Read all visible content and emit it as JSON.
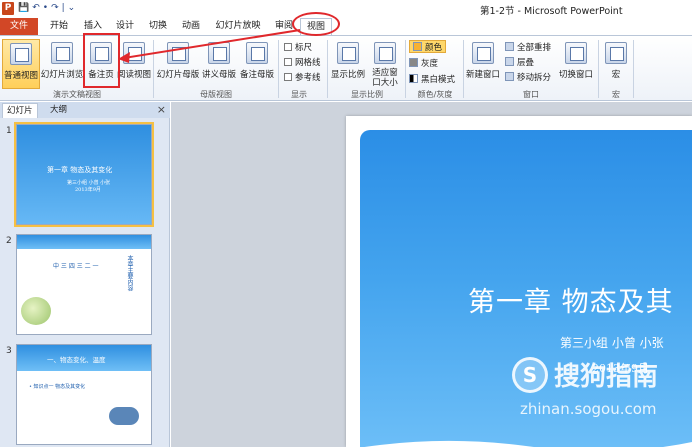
{
  "window": {
    "app_logo": "P",
    "title": "第1-2节 - Microsoft PowerPoint",
    "qat": [
      "💾",
      "↶",
      "•",
      "↷",
      "|",
      "⌄"
    ]
  },
  "tabs": {
    "file": "文件",
    "items": [
      "开始",
      "插入",
      "设计",
      "切换",
      "动画",
      "幻灯片放映",
      "审阅",
      "视图"
    ],
    "active": "视图"
  },
  "ribbon": {
    "presentation_views": {
      "label": "演示文稿视图",
      "normal": "普通视图",
      "slide_sorter": "幻灯片浏览",
      "notes_page": "备注页",
      "reading_view": "阅读视图"
    },
    "master_views": {
      "label": "母版视图",
      "slide_master": "幻灯片母版",
      "handout_master": "讲义母版",
      "notes_master": "备注母版"
    },
    "show": {
      "label": "显示",
      "ruler": "标尺",
      "gridlines": "网格线",
      "guides": "参考线"
    },
    "zoom": {
      "label": "显示比例",
      "zoom": "显示比例",
      "fit_window": "适应窗口大小"
    },
    "color": {
      "label": "颜色/灰度",
      "color": "颜色",
      "grayscale": "灰度",
      "black_white": "黑白模式"
    },
    "window_group": {
      "label": "窗口",
      "new_window": "新建窗口",
      "arrange_all": "全部重排",
      "cascade": "层叠",
      "move_split": "移动拆分",
      "switch_windows": "切换窗口"
    },
    "macros": {
      "label": "宏",
      "macros": "宏"
    }
  },
  "pane": {
    "tab_slides": "幻灯片",
    "tab_outline": "大纲",
    "close": "×",
    "thumbs": [
      {
        "num": "1",
        "title": "第一章 物态及其变化",
        "sub": "第三小组 小曾 小张",
        "date": "2013年9月"
      },
      {
        "num": "2",
        "title": "本章主要内容",
        "body": "中 三 四 三 二 一"
      },
      {
        "num": "3",
        "title": "一、物态变化、温度",
        "body": "• 知识点一 物态及其变化"
      }
    ]
  },
  "slide": {
    "title": "第一章  物态及其",
    "subtitle": "第三小组 小曾 小张",
    "date": "2013年9月"
  },
  "watermark": {
    "logo": "S",
    "text": "搜狗指南",
    "url": "zhinan.sogou.com"
  },
  "colors": {
    "file_tab": "#d24726",
    "annotation": "#e0282c",
    "slide_blue": "#2b8ee6"
  }
}
